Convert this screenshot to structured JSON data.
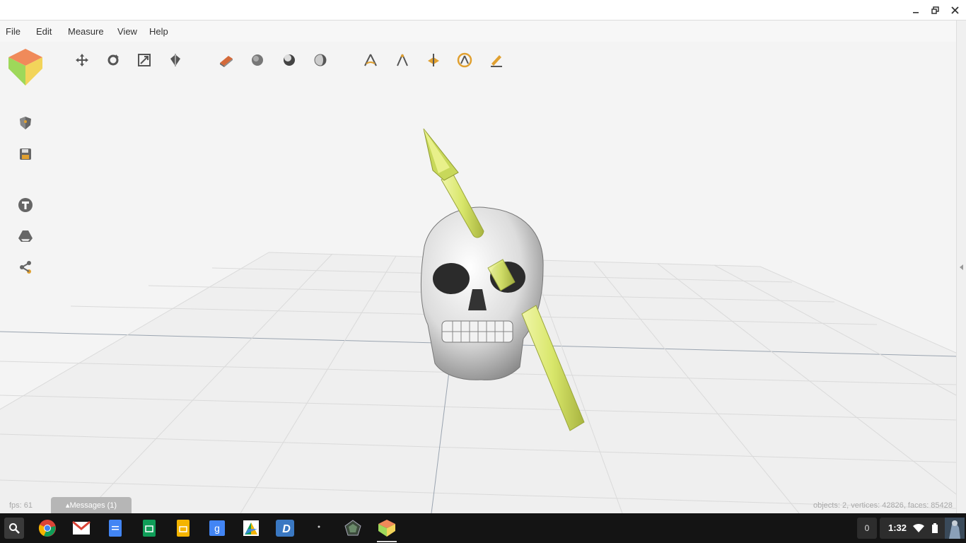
{
  "menu": {
    "file": "File",
    "edit": "Edit",
    "measure": "Measure",
    "view": "View",
    "help": "Help"
  },
  "toolbar": {
    "transform_tools": [
      "move-icon",
      "rotate-icon",
      "scale-icon",
      "mirror-icon"
    ],
    "render_tools": [
      "solid-layers-icon",
      "smooth-shading-icon",
      "glossy-shading-icon",
      "xray-shading-icon"
    ],
    "measure_tools": [
      "angle-measure-icon",
      "distance-measure-icon",
      "plane-measure-icon",
      "radius-measure-icon",
      "ruler-pencil-icon"
    ]
  },
  "sidebar": {
    "items": [
      "shield-icon",
      "save-icon",
      "text-icon",
      "drive-icon",
      "share-icon"
    ]
  },
  "viewport": {
    "scene_objects": [
      "skull",
      "arrow"
    ]
  },
  "status": {
    "fps": "fps: 61",
    "stats": "objects: 2, vertices: 42826, faces: 85428"
  },
  "messages_button": "▴Messages (1)",
  "taskbar": {
    "apps": [
      "chrome-icon",
      "gmail-icon",
      "docs-icon",
      "sheets-icon",
      "slides-icon",
      "google-icon",
      "drive-icon",
      "dictionary-icon",
      "ghost-icon",
      "pentagon-app-icon",
      "3d-viewer-icon"
    ],
    "notification_count": "0",
    "time": "1:32"
  },
  "colors": {
    "arrow": "#d8e66a",
    "skull": "#e6e6e6",
    "grid": "#d9d9d9",
    "taskbar": "#141414"
  }
}
